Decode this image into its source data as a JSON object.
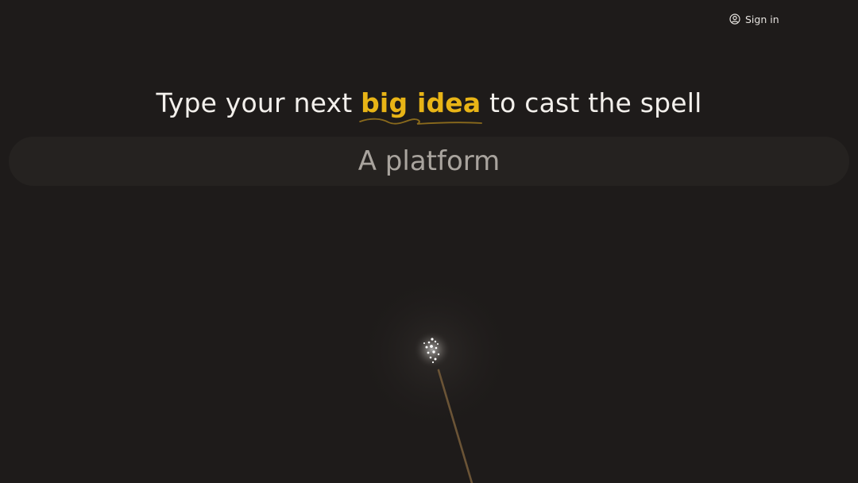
{
  "header": {
    "signin_label": "Sign in",
    "signin_icon": "user-circle-icon"
  },
  "hero": {
    "headline_before": "Type your next",
    "headline_accent": "big idea",
    "headline_after": "to cast the spell"
  },
  "idea_input": {
    "value": "A platform"
  },
  "colors": {
    "background": "#1e1b1a",
    "accent": "#e8b416",
    "input_background": "#252220",
    "wand": "#6b5436"
  }
}
